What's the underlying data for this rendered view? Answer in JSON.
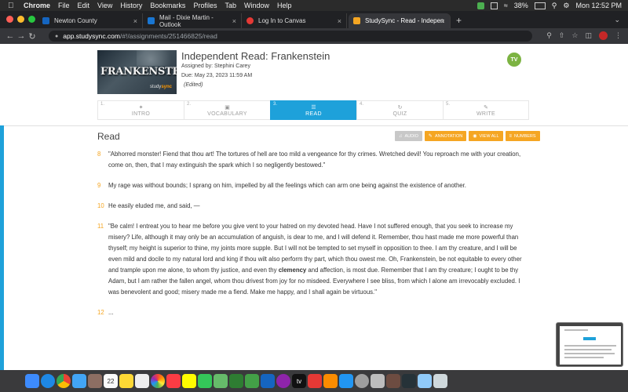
{
  "menubar": {
    "app_name": "Chrome",
    "items": [
      "File",
      "Edit",
      "View",
      "History",
      "Bookmarks",
      "Profiles",
      "Tab",
      "Window",
      "Help"
    ],
    "battery": "38%",
    "clock": "Mon 12:52 PM"
  },
  "browser": {
    "tabs": [
      {
        "label": "Newton County",
        "color": "#1565c0"
      },
      {
        "label": "Mail - Dixie Martin - Outlook",
        "color": "#1976d2"
      },
      {
        "label": "Log In to Canvas",
        "color": "#e53935"
      },
      {
        "label": "StudySync - Read - Independe",
        "color": "#f5a623",
        "active": true
      }
    ],
    "url_host": "app.studysync.com",
    "url_path": "/#!/assignments/251466825/read"
  },
  "assignment": {
    "cover_title": "FRANKENSTEIN",
    "cover_brand_a": "study",
    "cover_brand_b": "sync",
    "title": "Independent Read: Frankenstein",
    "assigned_by": "Assigned by: Stephini Carey",
    "due": "Due: May 23, 2023 11:59 AM",
    "edited": "(Edited)",
    "avatar_initials": "TV"
  },
  "steps": [
    {
      "num": "1.",
      "label": "INTRO",
      "icon": "intro-icon"
    },
    {
      "num": "2.",
      "label": "VOCABULARY",
      "icon": "camera-icon"
    },
    {
      "num": "3.",
      "label": "READ",
      "icon": "list-icon",
      "active": true
    },
    {
      "num": "4.",
      "label": "QUIZ",
      "icon": "refresh-icon"
    },
    {
      "num": "5.",
      "label": "WRITE",
      "icon": "pencil-icon"
    }
  ],
  "read": {
    "heading": "Read",
    "tools": {
      "audio": "AUDIO",
      "annotation": "ANNOTATION",
      "view_all": "VIEW ALL",
      "numbers": "NUMBERS"
    },
    "paragraphs": [
      {
        "num": "8",
        "text": "\"Abhorred monster! Fiend that thou art! The tortures of hell are too mild a vengeance for thy crimes. Wretched devil! You reproach me with your creation, come on, then, that I may extinguish the spark which I so negligently bestowed.\""
      },
      {
        "num": "9",
        "text": "My rage was without bounds; I sprang on him, impelled by all the feelings which can arm one being against the existence of another."
      },
      {
        "num": "10",
        "text": "He easily eluded me, and said, —"
      },
      {
        "num": "11",
        "text_before": "\"Be calm! I entreat you to hear me before you give vent to your hatred on my devoted head. Have I not suffered enough, that you seek to increase my misery? Life, although it may only be an accumulation of anguish, is dear to me, and I will defend it. Remember, thou hast made me more powerful than thyself; my height is superior to thine, my joints more supple. But I will not be tempted to set myself in opposition to thee. I am thy creature, and I will be even mild and docile to my natural lord and king if thou wilt also perform thy part, which thou owest me. Oh, Frankenstein, be not equitable to every other and trample upon me alone, to whom thy justice, and even thy ",
        "bold": "clemency",
        "text_after": " and affection, is most due. Remember that I am thy creature; I ought to be thy Adam, but I am rather the fallen angel, whom thou drivest from joy for no misdeed. Everywhere I see bliss, from which I alone am irrevocably excluded. I was benevolent and good; misery made me a fiend. Make me happy, and I shall again be virtuous.\""
      },
      {
        "num": "12",
        "text": "..."
      }
    ]
  },
  "colors": {
    "accent_blue": "#1ea1da",
    "orange": "#f5a623",
    "avatar_green": "#7cb342"
  }
}
